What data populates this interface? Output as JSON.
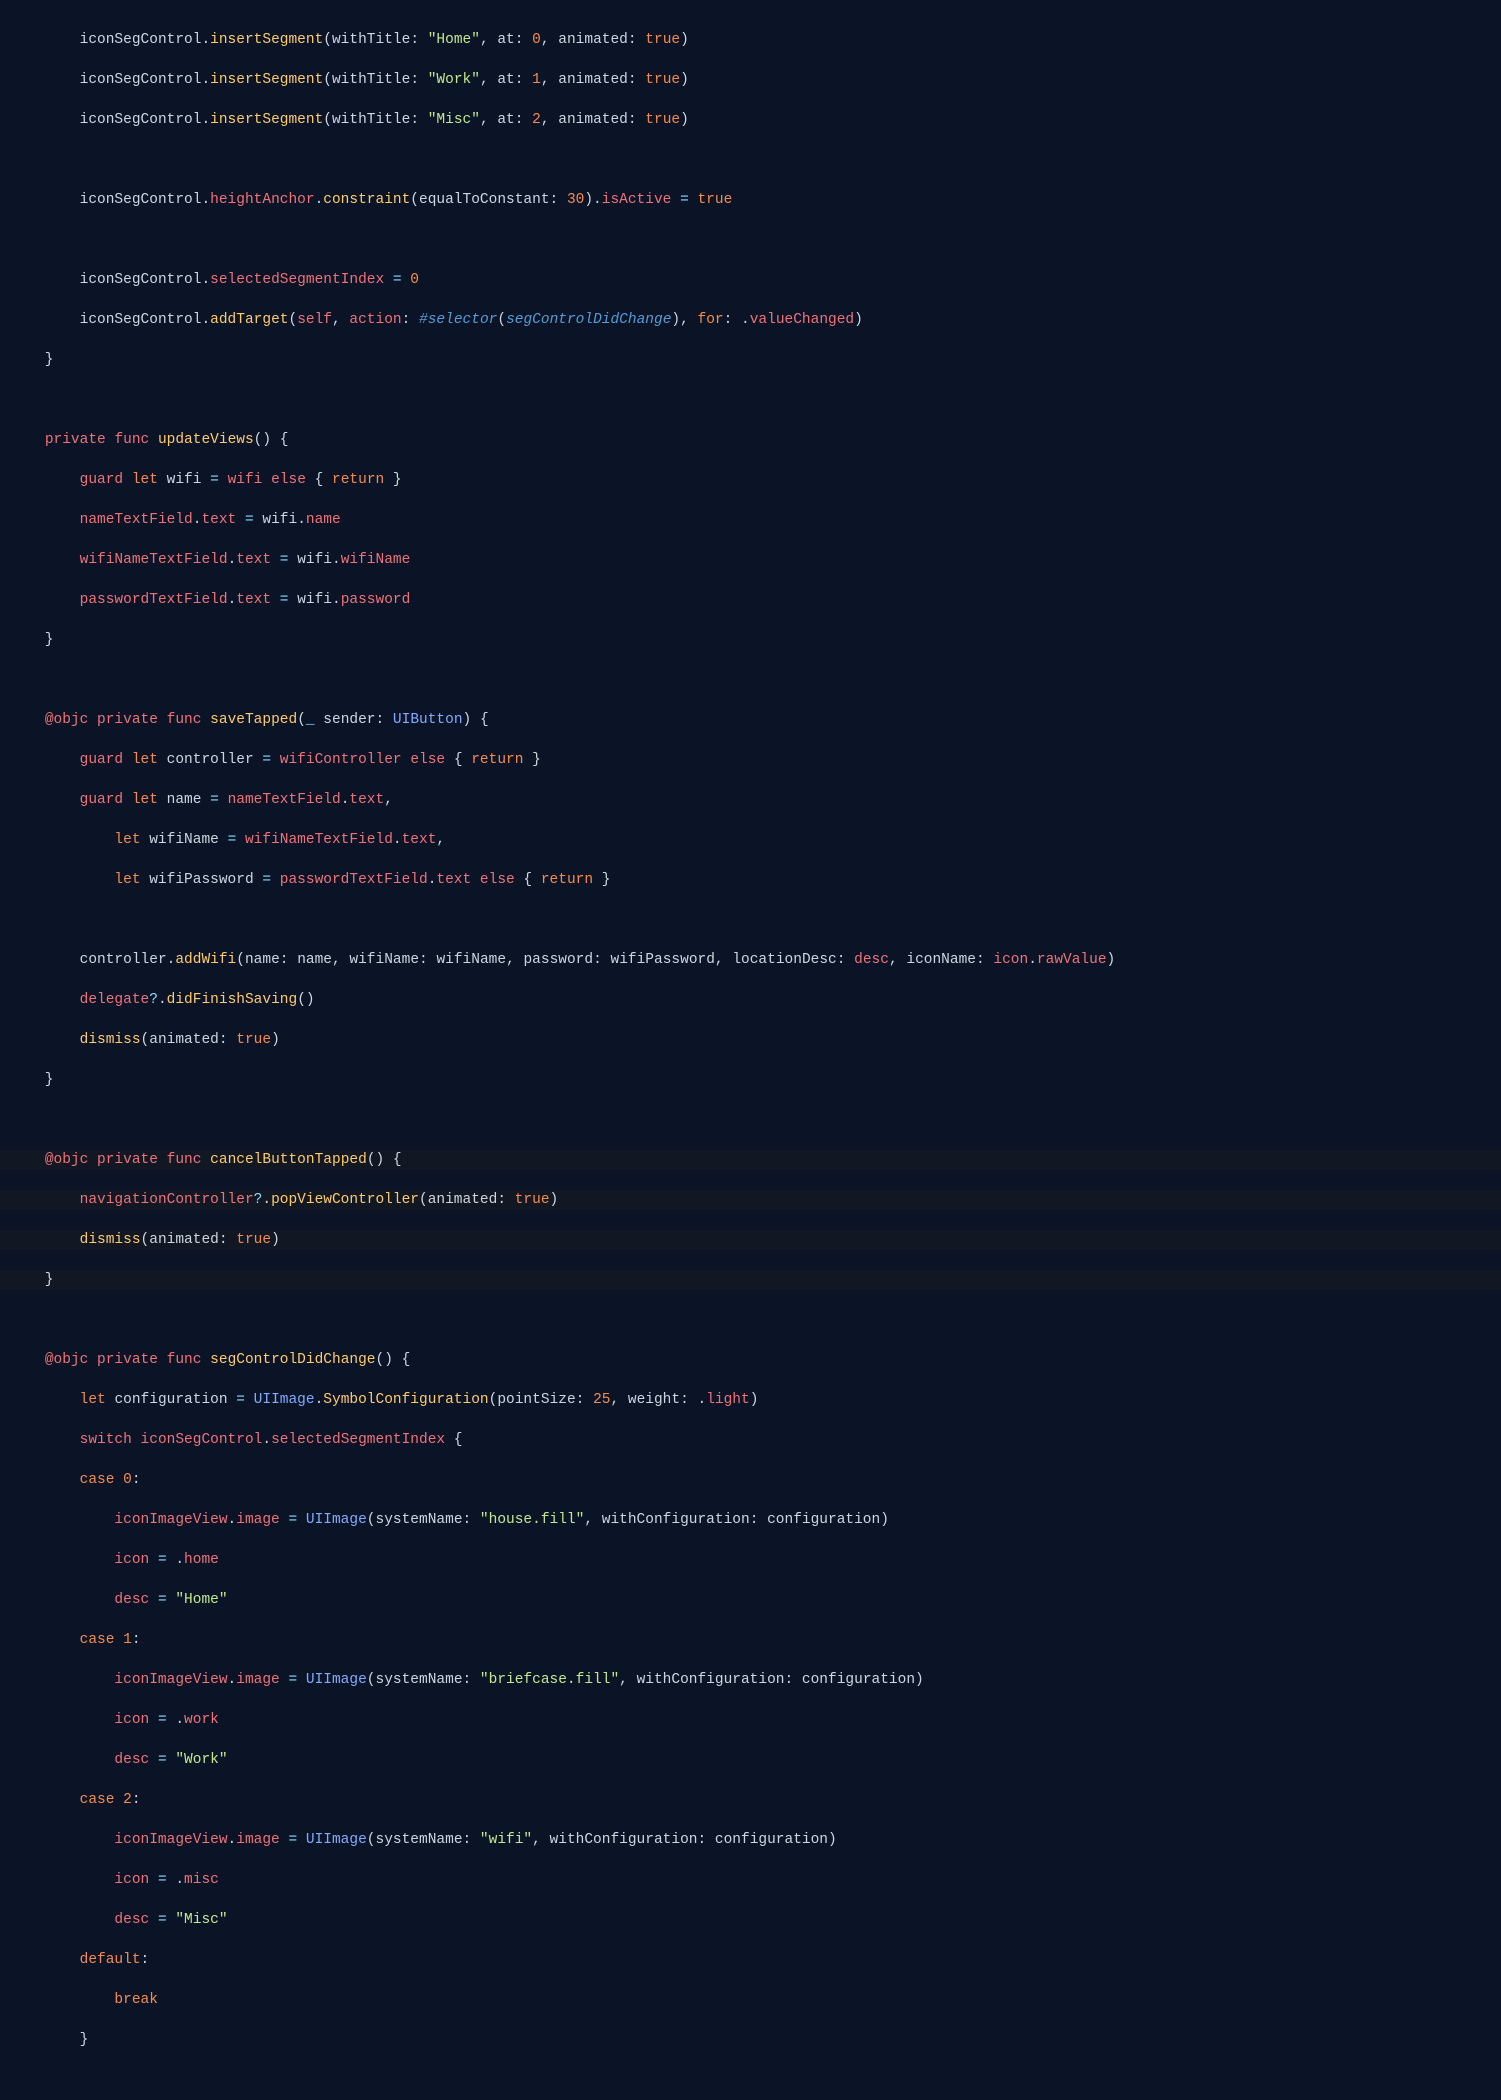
{
  "tokens": {
    "kw": {
      "private": "private",
      "func": "func",
      "guard": "guard",
      "else": "else",
      "return": "return",
      "self": "self",
      "action": "action",
      "objc": "@objc",
      "default": "default",
      "switch": "switch",
      "enum_light": "light",
      "enum_vc": "valueChanged",
      "enum_home": "home",
      "enum_work": "work",
      "enum_misc": "misc"
    },
    "kw2": {
      "let": "let",
      "true": "true",
      "case": "case",
      "break": "break",
      "for": "for"
    },
    "fn": {
      "insertSegment": "insertSegment",
      "constraint": "constraint",
      "addTarget": "addTarget",
      "updateViews": "updateViews",
      "saveTapped": "saveTapped",
      "cancelButtonTapped": "cancelButtonTapped",
      "segControlDidChange": "segControlDidChange",
      "addWifi": "addWifi",
      "didFinishSaving": "didFinishSaving",
      "dismiss": "dismiss",
      "popViewController": "popViewController",
      "SymbolConfiguration": "SymbolConfiguration",
      "UIImage_call": "UIImage"
    },
    "type": {
      "UIButton": "UIButton",
      "UIImage": "UIImage"
    },
    "sel": {
      "selector": "#selector",
      "segControlDidChange": "segControlDidChange"
    },
    "id": {
      "iconSegControl": "iconSegControl",
      "heightAnchor": "heightAnchor",
      "isActive": "isActive",
      "selectedSegmentIndex": "selectedSegmentIndex",
      "wifi": "wifi",
      "nameTextField": "nameTextField",
      "wifiNameTextField": "wifiNameTextField",
      "passwordTextField": "passwordTextField",
      "text": "text",
      "name": "name",
      "wifiName": "wifiName",
      "password": "password",
      "controller": "controller",
      "wifiController": "wifiController",
      "wifiPassword": "wifiPassword",
      "delegate": "delegate",
      "navigationController": "navigationController",
      "configuration": "configuration",
      "iconImageView": "iconImageView",
      "image": "image",
      "icon": "icon",
      "desc": "desc",
      "rawValue": "rawValue",
      "sender": "sender",
      "withTitle": "withTitle",
      "at": "at",
      "animated": "animated",
      "equalToConstant": "equalToConstant",
      "pointSize": "pointSize",
      "weight": "weight",
      "systemName": "systemName",
      "withConfiguration": "withConfiguration",
      "locationDesc": "locationDesc",
      "iconName": "iconName"
    },
    "str": {
      "Home": "\"Home\"",
      "Work": "\"Work\"",
      "Misc": "\"Misc\"",
      "house_fill": "\"house.fill\"",
      "briefcase_fill": "\"briefcase.fill\"",
      "wifi": "\"wifi\""
    },
    "num": {
      "n0": "0",
      "n1": "1",
      "n2": "2",
      "n25": "25",
      "n30": "30"
    },
    "op": {
      "eq": "=",
      "q": "?",
      "und": "_"
    }
  }
}
